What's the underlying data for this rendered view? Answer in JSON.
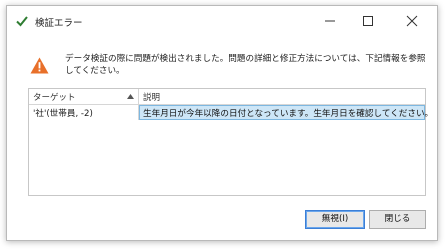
{
  "window": {
    "title": "検証エラー"
  },
  "message": "データ検証の際に問題が検出されました。問題の詳細と修正方法については、下記情報を参照してください。",
  "grid": {
    "columns": [
      "ターゲット",
      "説明"
    ],
    "rows": [
      {
        "target": "'社'(世帯員, -2)",
        "description": "生年月日が今年以降の日付となっています。生年月日を確認してください。"
      }
    ]
  },
  "buttons": {
    "ignore": "無視(I)",
    "close": "閉じる"
  },
  "colors": {
    "accent": "#2f7d32",
    "warning": "#e8702a",
    "selection": "#cde6f7"
  }
}
